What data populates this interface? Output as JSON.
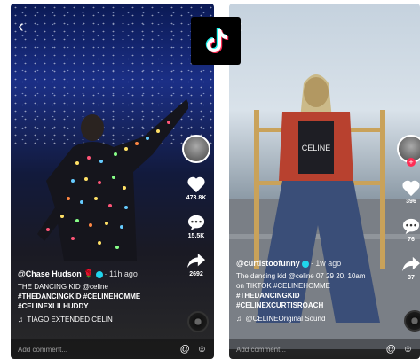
{
  "left": {
    "back_icon": "back-chevron-icon",
    "username": "@Chase Hudson",
    "user_emoji": "🌹",
    "time_ago": "· 11h ago",
    "caption_line1": "THE DANCING KID @celine",
    "caption_tags": [
      "#THEDANCINGKID #CELINEHOMME",
      "#CELINEXLILHUDDY"
    ],
    "sound": "TIAGO EXTENDED CELIN",
    "likes": "473.8K",
    "comments": "15.5K",
    "shares": "2692",
    "add_comment": "Add comment..."
  },
  "right": {
    "back_icon": "back-chevron-icon",
    "username": "@curtistoofunny",
    "time_ago": "· 1w ago",
    "caption_lines": [
      "The dancing kid @celine 07 29 20, 10am",
      "on TIKTOK #CELINEHOMME"
    ],
    "caption_tags": [
      "#THEDANCINGKID",
      "#CELINEXCURTISROACH"
    ],
    "sound": "@CELINEOriginal Sound",
    "likes": "396",
    "comments": "76",
    "shares": "37",
    "add_comment": "Add comment..."
  },
  "app_logo": "tiktok-logo",
  "colors": {
    "accent": "#ff2d55",
    "verified": "#20d5ec"
  }
}
